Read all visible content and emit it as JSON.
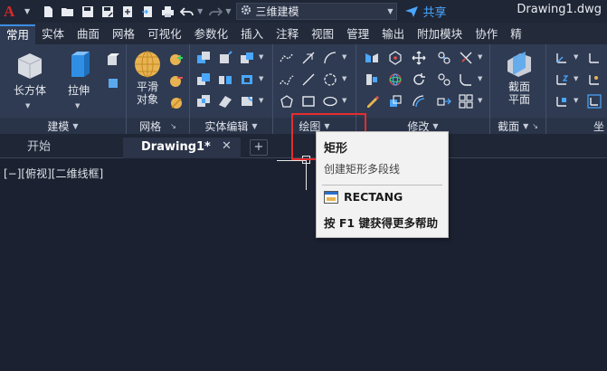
{
  "app": {
    "logo_letter": "A",
    "workspace": "三维建模",
    "share_label": "共享",
    "document_title": "Drawing1.dwg"
  },
  "quick_access": {
    "icons": [
      "new-file-icon",
      "open-folder-icon",
      "save-icon",
      "save-as-icon",
      "open-web-icon",
      "save-web-icon",
      "print-icon",
      "undo-icon",
      "redo-icon"
    ]
  },
  "ribbon_tabs": [
    "常用",
    "实体",
    "曲面",
    "网格",
    "可视化",
    "参数化",
    "插入",
    "注释",
    "视图",
    "管理",
    "输出",
    "附加模块",
    "协作",
    "精"
  ],
  "ribbon": {
    "panels": {
      "modeling": "建模",
      "mesh": "网格",
      "solid_edit": "实体编辑",
      "draw": "绘图",
      "modify": "修改",
      "section": "截面",
      "coords": "坐"
    },
    "buttons": {
      "box": "长方体",
      "extrude": "拉伸",
      "smooth_l1": "平滑",
      "smooth_l2": "对象",
      "section_l1": "截面",
      "section_l2": "平面"
    }
  },
  "doc_tabs": {
    "start": "开始",
    "drawing": "Drawing1*",
    "close": "✕",
    "add": "+"
  },
  "canvas": {
    "view_label": "[−][俯视][二维线框]"
  },
  "tooltip": {
    "title": "矩形",
    "description": "创建矩形多段线",
    "command": "RECTANG",
    "help": "按 F1 键获得更多帮助"
  },
  "colors": {
    "accent_blue": "#3d8de4",
    "highlight_red": "#e52d2d",
    "logo_red": "#d8282a"
  }
}
